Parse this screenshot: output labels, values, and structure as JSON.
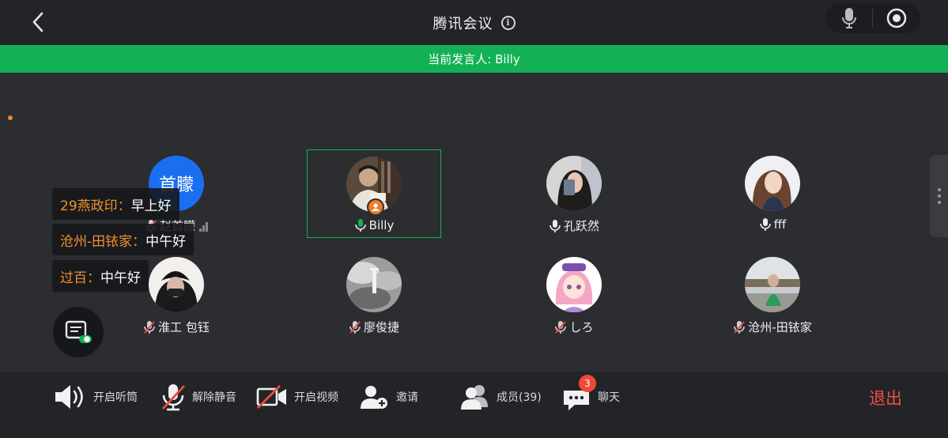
{
  "header": {
    "title": "腾讯会议",
    "back_icon": "chevron-left-icon",
    "info_glyph": "i"
  },
  "speaker_banner": {
    "label": "当前发言人: Billy"
  },
  "participants": [
    {
      "name": "赵首朦",
      "avatar_text": "首朦",
      "avatar_type": "text",
      "muted": true,
      "active": false
    },
    {
      "name": "Billy",
      "avatar_type": "photo",
      "muted": false,
      "active": true,
      "is_host": true
    },
    {
      "name": "孔跃然",
      "avatar_type": "photo",
      "muted": false,
      "active": false
    },
    {
      "name": "fff",
      "avatar_type": "photo",
      "muted": false,
      "active": false
    },
    {
      "name": "淮工 包钰",
      "avatar_type": "photo",
      "muted": true,
      "active": false
    },
    {
      "name": "廖俊捷",
      "avatar_type": "photo",
      "muted": true,
      "active": false
    },
    {
      "name": "しろ",
      "avatar_type": "photo",
      "muted": true,
      "active": false
    },
    {
      "name": "沧州-田铱家",
      "avatar_type": "photo",
      "muted": true,
      "active": false
    }
  ],
  "chat_messages": [
    {
      "sender": "29燕政印：",
      "text": "早上好"
    },
    {
      "sender": "沧州-田铱家：",
      "text": "中午好"
    },
    {
      "sender": "过百：",
      "text": "中午好"
    }
  ],
  "toolbar": {
    "speaker_label": "开启听筒",
    "unmute_label": "解除静音",
    "video_label": "开启视频",
    "invite_label": "邀请",
    "members_label": "成员(39)",
    "chat_label": "聊天",
    "chat_badge": "3",
    "exit_label": "退出"
  },
  "colors": {
    "accent_green": "#12b155",
    "exit_red": "#f04f3e",
    "badge_red": "#ee4a36",
    "chat_sender_orange": "#f0912c",
    "host_badge_orange": "#f07b2a"
  }
}
